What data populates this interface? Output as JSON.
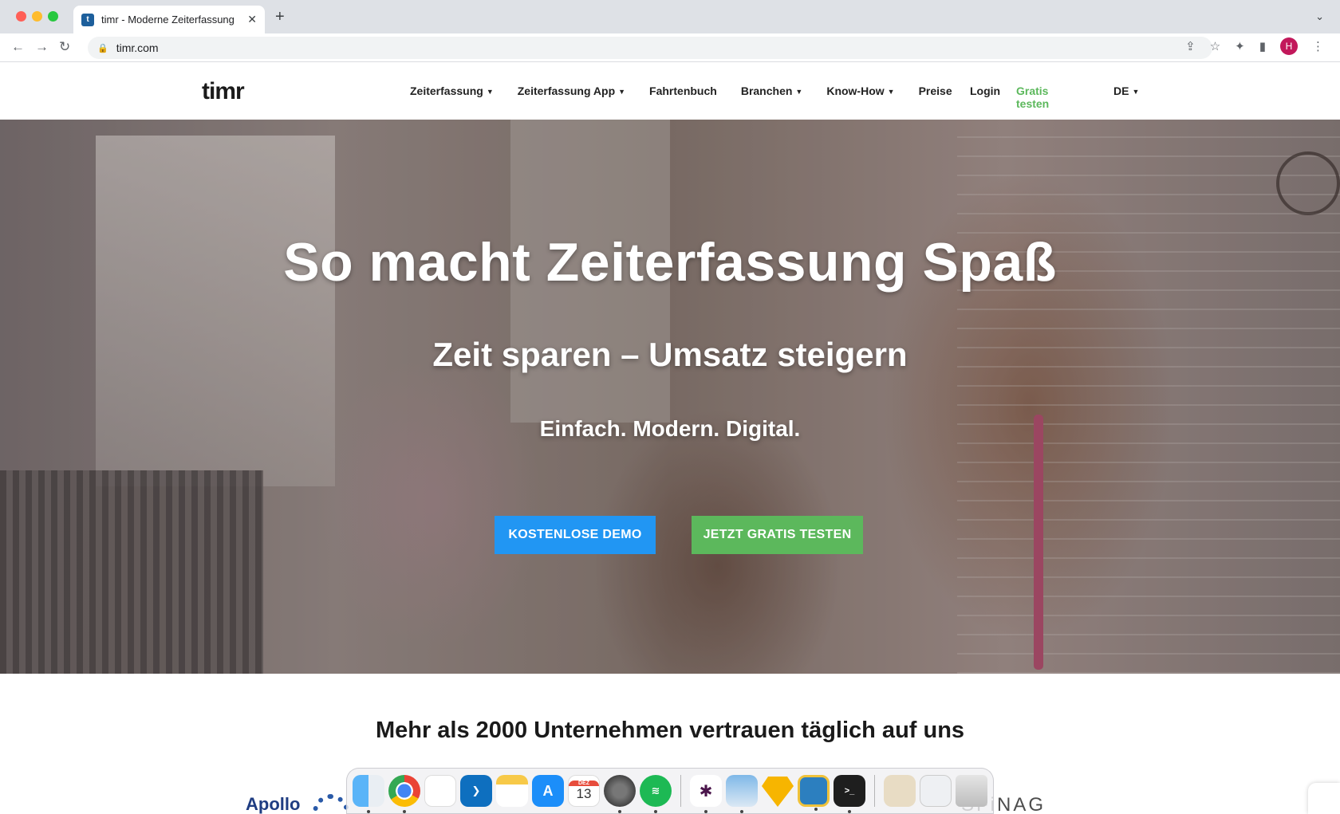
{
  "browser": {
    "tab_title": "timr - Moderne Zeiterfassung",
    "tab_close": "✕",
    "new_tab": "+",
    "url": "timr.com",
    "profile_initial": "H"
  },
  "site": {
    "logo": "timr",
    "nav": [
      {
        "label": "Zeiterfassung",
        "dropdown": true
      },
      {
        "label": "Zeiterfassung App",
        "dropdown": true
      },
      {
        "label": "Fahrtenbuch",
        "dropdown": false
      },
      {
        "label": "Branchen",
        "dropdown": true
      },
      {
        "label": "Know-How",
        "dropdown": true
      },
      {
        "label": "Preise",
        "dropdown": false
      }
    ],
    "login": "Login",
    "trial_link": "Gratis testen",
    "language": "DE"
  },
  "hero": {
    "title": "So macht Zeiterfassung Spaß",
    "subtitle": "Zeit sparen – Umsatz steigern",
    "tagline": "Einfach. Modern. Digital.",
    "demo_button": "KOSTENLOSE DEMO",
    "trial_button": "JETZT GRATIS TESTEN"
  },
  "trust": {
    "heading": "Mehr als 2000 Unternehmen vertrauen täglich auf uns",
    "logos": [
      "Apollo",
      "SFiNAG"
    ]
  },
  "dock": {
    "calendar_month": "DEZ",
    "calendar_day": "13",
    "apps": [
      "finder-icon",
      "chrome-icon",
      "reminders-icon",
      "vscode-icon",
      "notes-icon",
      "app-store-icon",
      "calendar-icon",
      "system-settings-icon",
      "spotify-icon",
      "slack-icon",
      "preview-icon",
      "sketch-icon",
      "archive-icon",
      "terminal-icon",
      "documents-icon",
      "files-icon",
      "trash-icon"
    ]
  }
}
